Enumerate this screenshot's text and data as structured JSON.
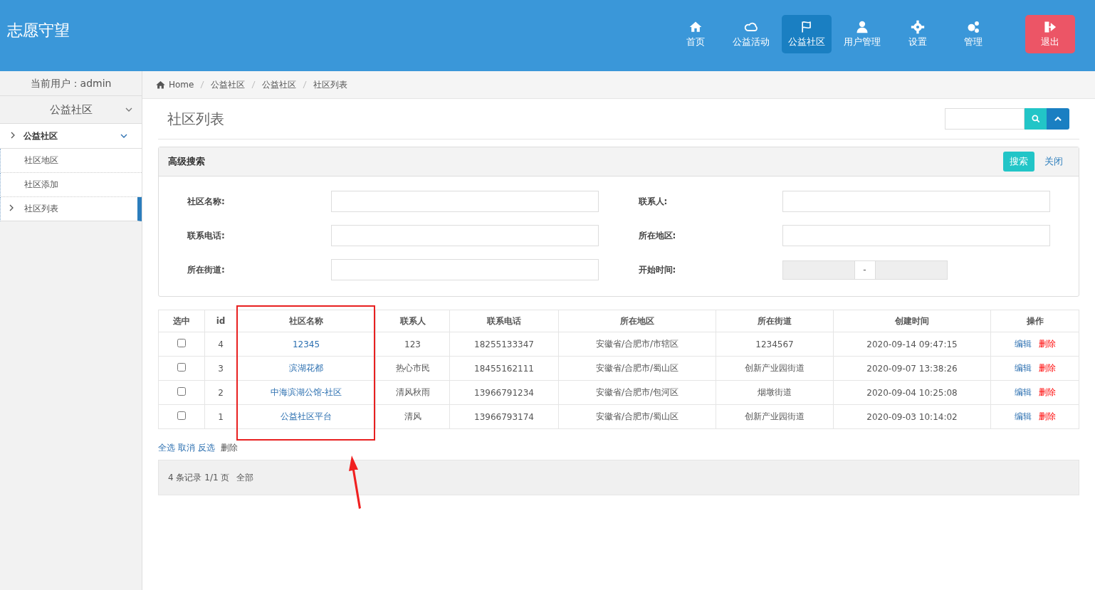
{
  "app_title": "志愿守望",
  "nav": [
    {
      "label": "首页",
      "selected": false,
      "kind": "normal"
    },
    {
      "label": "公益活动",
      "selected": false,
      "kind": "normal"
    },
    {
      "label": "公益社区",
      "selected": true,
      "kind": "normal"
    },
    {
      "label": "用户管理",
      "selected": false,
      "kind": "normal"
    },
    {
      "label": "设置",
      "selected": false,
      "kind": "normal"
    },
    {
      "label": "管理",
      "selected": false,
      "kind": "normal"
    },
    {
      "label": "退出",
      "selected": false,
      "kind": "danger"
    }
  ],
  "sidebar": {
    "current_user": "当前用户：admin",
    "section": "公益社区",
    "tree": {
      "label": "公益社区",
      "expanded": true,
      "children": [
        {
          "label": "社区地区",
          "selected": false
        },
        {
          "label": "社区添加",
          "selected": false
        },
        {
          "label": "社区列表",
          "selected": true
        }
      ]
    }
  },
  "breadcrumb": [
    "Home",
    "公益社区",
    "公益社区",
    "社区列表"
  ],
  "page_title": "社区列表",
  "search_panel": {
    "title": "高级搜索",
    "search_button": "搜索",
    "close_link": "关闭",
    "fields": [
      {
        "label": "社区名称:",
        "kind": "text"
      },
      {
        "label": "联系人:",
        "kind": "text"
      },
      {
        "label": "联系电话:",
        "kind": "text"
      },
      {
        "label": "所在地区:",
        "kind": "text"
      },
      {
        "label": "所在街道:",
        "kind": "text"
      },
      {
        "label": "开始时间:",
        "kind": "daterange",
        "separator": "-"
      }
    ]
  },
  "table": {
    "columns": [
      "选中",
      "id",
      "社区名称",
      "联系人",
      "联系电话",
      "所在地区",
      "所在街道",
      "创建时间",
      "操作"
    ],
    "rows": [
      {
        "checked": false,
        "id": "4",
        "name": "12345",
        "contact": "123",
        "phone": "18255133347",
        "region": "安徽省/合肥市/市辖区",
        "street": "1234567",
        "created": "2020-09-14 09:47:15",
        "edit": "编辑",
        "delete": "删除"
      },
      {
        "checked": false,
        "id": "3",
        "name": "滨湖花都",
        "contact": "热心市民",
        "phone": "18455162111",
        "region": "安徽省/合肥市/蜀山区",
        "street": "创新产业园街道",
        "created": "2020-09-07 13:38:26",
        "edit": "编辑",
        "delete": "删除"
      },
      {
        "checked": false,
        "id": "2",
        "name": "中海滨湖公馆-社区",
        "contact": "清风秋雨",
        "phone": "13966791234",
        "region": "安徽省/合肥市/包河区",
        "street": "烟墩街道",
        "created": "2020-09-04 10:25:08",
        "edit": "编辑",
        "delete": "删除"
      },
      {
        "checked": false,
        "id": "1",
        "name": "公益社区平台",
        "contact": "清风",
        "phone": "13966793174",
        "region": "安徽省/合肥市/蜀山区",
        "street": "创新产业园街道",
        "created": "2020-09-03 10:14:02",
        "edit": "编辑",
        "delete": "删除"
      }
    ]
  },
  "bulk_actions": [
    "全选",
    "取消",
    "反选",
    "删除"
  ],
  "pager": {
    "summary": "4 条记录 1/1 页",
    "all": "全部"
  }
}
